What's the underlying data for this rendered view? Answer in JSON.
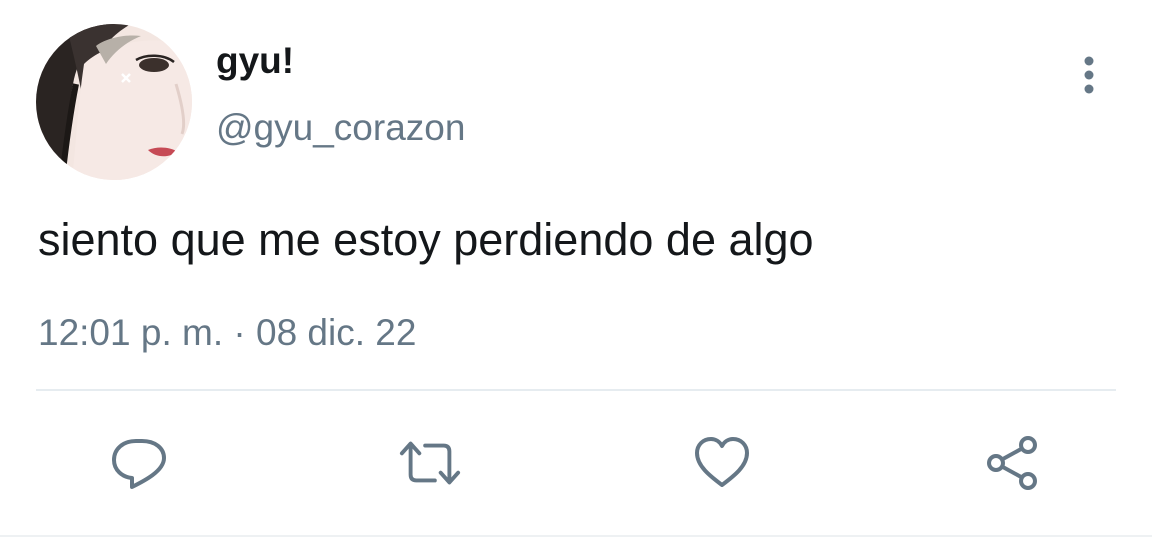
{
  "user": {
    "display_name": "gyu!",
    "handle": "@gyu_corazon"
  },
  "tweet": {
    "text": "siento que me estoy perdiendo de algo",
    "timestamp": "12:01 p. m. · 08 dic. 22"
  },
  "actions": [
    {
      "icon": "reply-icon"
    },
    {
      "icon": "retweet-icon"
    },
    {
      "icon": "like-icon"
    },
    {
      "icon": "share-icon"
    }
  ],
  "colors": {
    "primary_text": "#14171a",
    "secondary_text": "#657786",
    "icon": "#657786",
    "divider": "#e6ecf0",
    "background": "#ffffff"
  }
}
